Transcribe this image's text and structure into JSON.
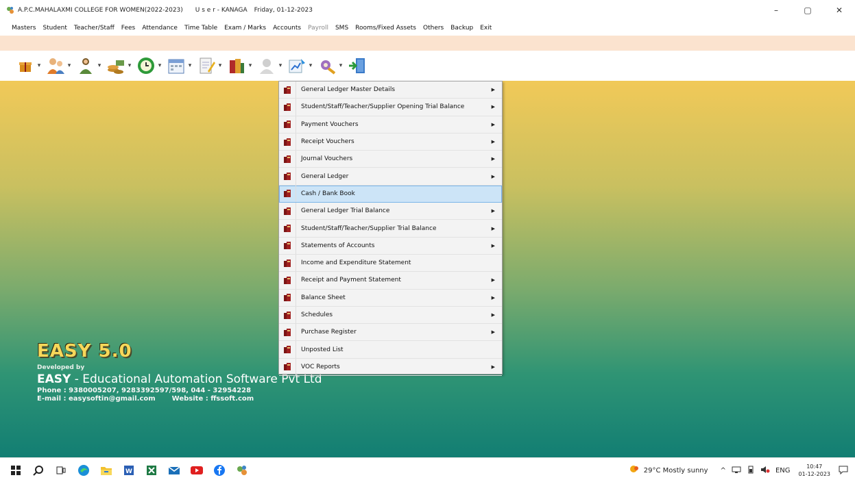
{
  "window": {
    "title": "A.P.C.MAHALAXMI COLLEGE FOR WOMEN(2022-2023)",
    "user": "U s e r - KANAGA",
    "date": "Friday, 01-12-2023",
    "controls": {
      "minimize": "–",
      "maximize": "▢",
      "close": "✕"
    }
  },
  "menubar": [
    {
      "label": "Masters",
      "enabled": true
    },
    {
      "label": "Student",
      "enabled": true
    },
    {
      "label": "Teacher/Staff",
      "enabled": true
    },
    {
      "label": "Fees",
      "enabled": true
    },
    {
      "label": "Attendance",
      "enabled": true
    },
    {
      "label": "Time Table",
      "enabled": true
    },
    {
      "label": "Exam / Marks",
      "enabled": true
    },
    {
      "label": "Accounts",
      "enabled": true
    },
    {
      "label": "Payroll",
      "enabled": false
    },
    {
      "label": "SMS",
      "enabled": true
    },
    {
      "label": "Rooms/Fixed Assets",
      "enabled": true
    },
    {
      "label": "Others",
      "enabled": true
    },
    {
      "label": "Backup",
      "enabled": true
    },
    {
      "label": "Exit",
      "enabled": true
    }
  ],
  "toolbar": {
    "drop_glyph": "▾",
    "icons": [
      "gift-icon",
      "teacher-icon",
      "students-icon",
      "money-icon",
      "clock-icon",
      "calendar-icon",
      "notepad-icon",
      "books-icon",
      "person-icon",
      "chart-icon",
      "tools-icon",
      "exit-door-icon"
    ]
  },
  "dropdown": {
    "arrow_glyph": "▶",
    "items": [
      {
        "label": "General Ledger Master Details",
        "submenu": true,
        "selected": false
      },
      {
        "label": "Student/Staff/Teacher/Supplier Opening Trial Balance",
        "submenu": true,
        "selected": false
      },
      {
        "label": "Payment Vouchers",
        "submenu": true,
        "selected": false
      },
      {
        "label": "Receipt Vouchers",
        "submenu": true,
        "selected": false
      },
      {
        "label": "Journal Vouchers",
        "submenu": true,
        "selected": false
      },
      {
        "label": "General Ledger",
        "submenu": true,
        "selected": false
      },
      {
        "label": "Cash / Bank Book",
        "submenu": false,
        "selected": true
      },
      {
        "label": "General Ledger Trial Balance",
        "submenu": true,
        "selected": false
      },
      {
        "label": "Student/Staff/Teacher/Supplier Trial Balance",
        "submenu": true,
        "selected": false
      },
      {
        "label": "Statements of Accounts",
        "submenu": true,
        "selected": false
      },
      {
        "label": "Income and Expenditure Statement",
        "submenu": false,
        "selected": false
      },
      {
        "label": "Receipt and Payment Statement",
        "submenu": true,
        "selected": false
      },
      {
        "label": "Balance Sheet",
        "submenu": true,
        "selected": false
      },
      {
        "label": "Schedules",
        "submenu": true,
        "selected": false
      },
      {
        "label": "Purchase Register",
        "submenu": true,
        "selected": false
      },
      {
        "label": "Unposted List",
        "submenu": false,
        "selected": false
      },
      {
        "label": "VOC Reports",
        "submenu": true,
        "selected": false
      }
    ]
  },
  "branding": {
    "title": "EASY 5.0",
    "developed_by": "Developed by",
    "company_bold": "EASY",
    "company_rest": " - Educational Automation Software Pvt Ltd",
    "phone": "Phone : 9380005207, 9283392597/598,  044 - 32954228",
    "email": "E-mail : easysoftin@gmail.com",
    "website": "Website : ffssoft.com"
  },
  "taskbar": {
    "apps": [
      "windows-start-icon",
      "search-icon",
      "task-view-icon",
      "edge-icon",
      "file-explorer-icon",
      "word-icon",
      "excel-icon",
      "mail-icon",
      "youtube-icon",
      "facebook-icon",
      "easy-app-icon"
    ],
    "weather": "29°C  Mostly sunny",
    "tray": {
      "chevron": "^",
      "language": "ENG"
    },
    "time": "10:47",
    "date": "01-12-2023"
  },
  "colors": {
    "peach_strip": "#fbe3cf",
    "selection": "#cce4f7",
    "brand_yellow": "#f7d85a"
  }
}
